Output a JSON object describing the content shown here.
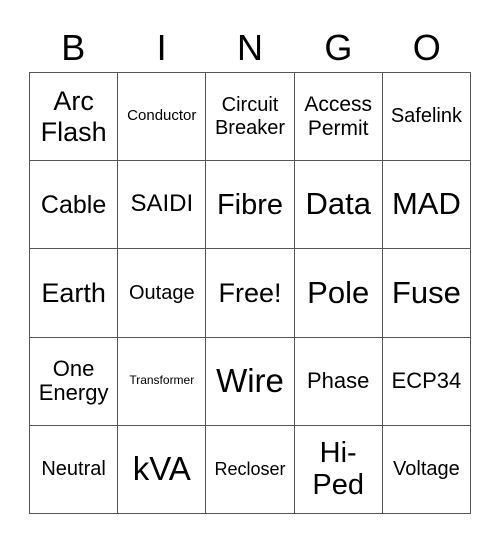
{
  "header": [
    "B",
    "I",
    "N",
    "G",
    "O"
  ],
  "cells": [
    [
      "Arc Flash",
      "Conductor",
      "Circuit Breaker",
      "Access Permit",
      "Safelink"
    ],
    [
      "Cable",
      "SAIDI",
      "Fibre",
      "Data",
      "MAD"
    ],
    [
      "Earth",
      "Outage",
      "Free!",
      "Pole",
      "Fuse"
    ],
    [
      "One Energy",
      "Transformer",
      "Wire",
      "Phase",
      "ECP34"
    ],
    [
      "Neutral",
      "kVA",
      "Recloser",
      "Hi-Ped",
      "Voltage"
    ]
  ]
}
